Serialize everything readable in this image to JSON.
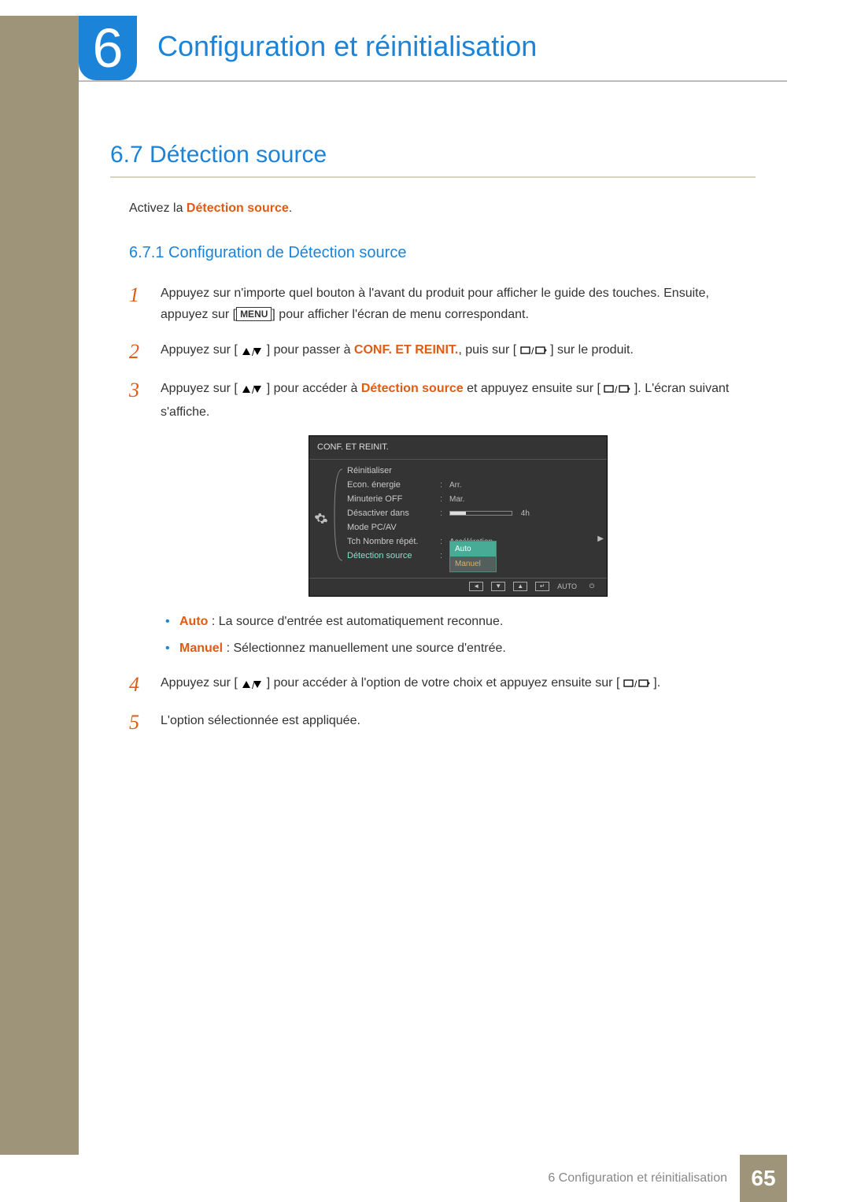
{
  "chapter": {
    "number": "6",
    "title": "Configuration et réinitialisation"
  },
  "section": {
    "number": "6.7",
    "title": "Détection source",
    "heading": "6.7   Détection source"
  },
  "intro": {
    "prefix": "Activez la ",
    "highlight": "Détection source",
    "suffix": "."
  },
  "subsection": {
    "heading": "6.7.1   Configuration de Détection source"
  },
  "steps": {
    "s1": {
      "num": "1",
      "text_a": "Appuyez sur n'importe quel bouton à l'avant du produit pour afficher le guide des touches. Ensuite, appuyez sur [",
      "menu_label": "MENU",
      "text_b": "] pour afficher l'écran de menu correspondant."
    },
    "s2": {
      "num": "2",
      "text_a": "Appuyez sur [",
      "text_b": "] pour passer à ",
      "hl": "CONF. ET REINIT.",
      "text_c": ", puis sur [",
      "text_d": "] sur le produit."
    },
    "s3": {
      "num": "3",
      "text_a": "Appuyez sur [",
      "text_b": "] pour accéder à ",
      "hl": "Détection source",
      "text_c": " et appuyez ensuite sur [",
      "text_d": "]. L'écran suivant s'affiche."
    },
    "s4": {
      "num": "4",
      "text_a": "Appuyez sur [",
      "text_b": "] pour accéder à l'option de votre choix et appuyez ensuite sur [",
      "text_c": "]."
    },
    "s5": {
      "num": "5",
      "text": "L'option sélectionnée est appliquée."
    }
  },
  "bullets": {
    "b1": {
      "hl": "Auto",
      "text": " : La source d'entrée est automatiquement reconnue."
    },
    "b2": {
      "hl": "Manuel",
      "text": " : Sélectionnez manuellement une source d'entrée."
    }
  },
  "osd": {
    "title": "CONF. ET REINIT.",
    "items": {
      "reinit": "Réinitialiser",
      "econ": "Econ. énergie",
      "econ_val": "Arr.",
      "minuterie": "Minuterie OFF",
      "minuterie_val": "Mar.",
      "desact": "Désactiver dans",
      "desact_val": "4h",
      "mode": "Mode PC/AV",
      "tch": "Tch Nombre répét.",
      "tch_val": "Accélération",
      "detect": "Détection source",
      "opt_auto": "Auto",
      "opt_manuel": "Manuel"
    },
    "footer_auto": "AUTO"
  },
  "footer": {
    "text": "6  Configuration et réinitialisation",
    "page": "65"
  }
}
